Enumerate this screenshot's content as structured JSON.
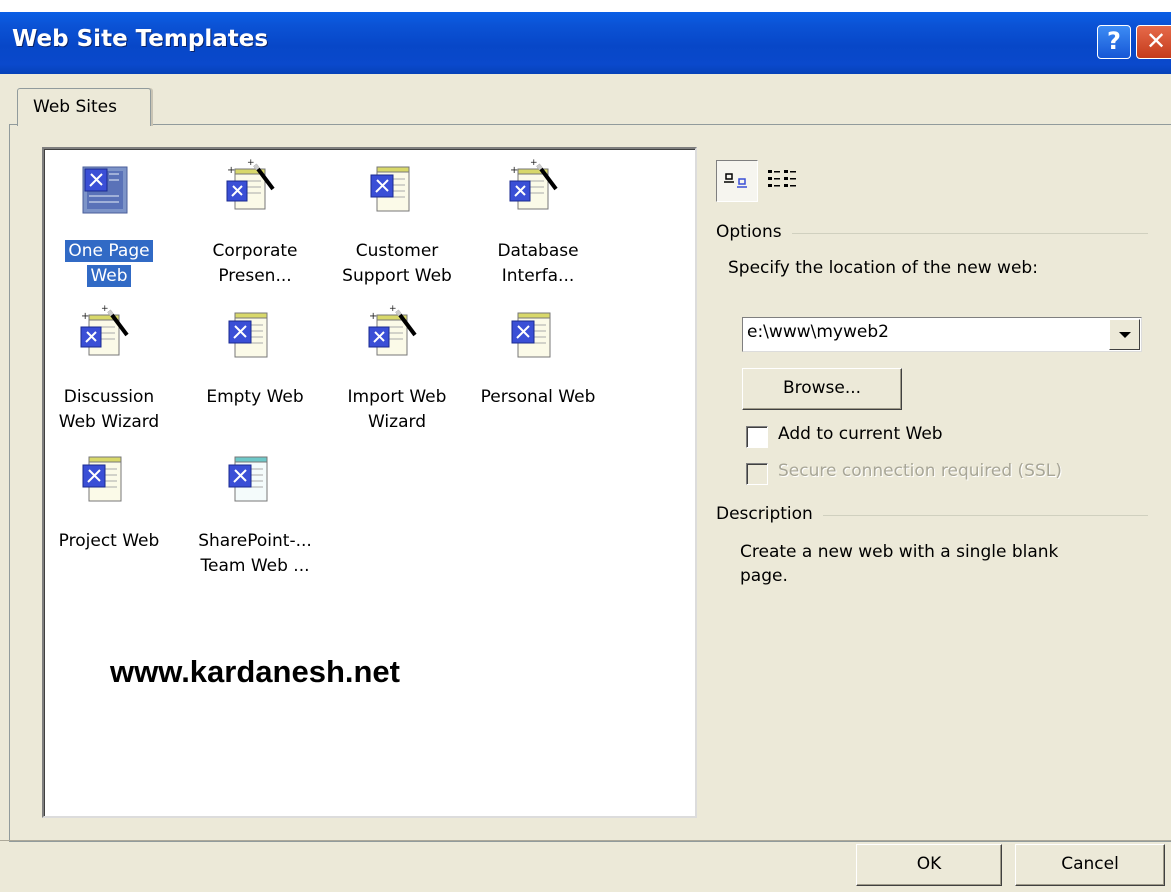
{
  "window": {
    "title": "Web Site Templates",
    "help_label": "?",
    "close_label": "✕"
  },
  "tabs": [
    {
      "label": "Web Sites",
      "active": true
    }
  ],
  "templates": [
    {
      "label_lines": [
        "One Page",
        "Web"
      ],
      "icon": "one-page-web-icon",
      "selected": true
    },
    {
      "label_lines": [
        "Corporate",
        "Presen..."
      ],
      "icon": "wizard-template-icon",
      "selected": false
    },
    {
      "label_lines": [
        "Customer",
        "Support Web"
      ],
      "icon": "web-template-icon",
      "selected": false
    },
    {
      "label_lines": [
        "Database",
        "Interfa..."
      ],
      "icon": "wizard-template-icon",
      "selected": false
    },
    {
      "label_lines": [
        "Discussion",
        "Web Wizard"
      ],
      "icon": "wizard-template-icon",
      "selected": false
    },
    {
      "label_lines": [
        "Empty Web"
      ],
      "icon": "web-template-icon",
      "selected": false
    },
    {
      "label_lines": [
        "Import Web",
        "Wizard"
      ],
      "icon": "wizard-template-icon",
      "selected": false
    },
    {
      "label_lines": [
        "Personal Web"
      ],
      "icon": "web-template-icon",
      "selected": false
    },
    {
      "label_lines": [
        "Project Web"
      ],
      "icon": "web-template-icon",
      "selected": false
    },
    {
      "label_lines": [
        "SharePoint-...",
        "Team Web ..."
      ],
      "icon": "sharepoint-template-icon",
      "selected": false
    }
  ],
  "watermark": "www.kardanesh.net",
  "view_buttons": [
    {
      "name": "large-icons-view-button",
      "icon": "large-icons-icon",
      "active": true
    },
    {
      "name": "list-view-button",
      "icon": "list-view-icon",
      "active": false
    }
  ],
  "options": {
    "group_label": "Options",
    "location_prompt": "Specify the location of the new web:",
    "location_value": "e:\\www\\myweb2",
    "browse_label": "Browse...",
    "add_to_current_label": "Add to current Web",
    "add_to_current_checked": false,
    "ssl_label": "Secure connection required (SSL)",
    "ssl_checked": false,
    "ssl_enabled": false
  },
  "description": {
    "group_label": "Description",
    "text_lines": [
      "Create a new web with a single blank",
      "page."
    ]
  },
  "footer": {
    "ok_label": "OK",
    "cancel_label": "Cancel"
  },
  "colors": {
    "titlebar": "#0a5fe6",
    "dialog_bg": "#ece9d8",
    "selection": "#316ac5",
    "icon_blue": "#3a4fd6"
  }
}
